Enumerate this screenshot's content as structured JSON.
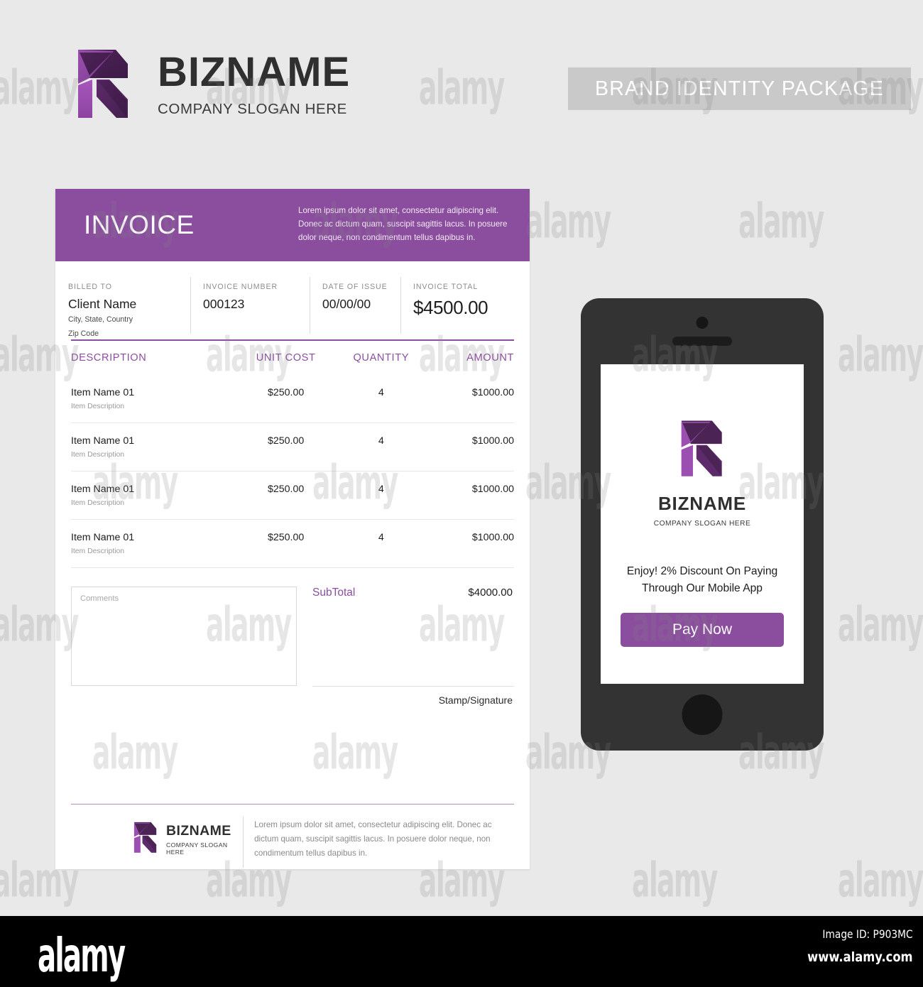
{
  "header": {
    "brand_name": "BIZNAME",
    "slogan": "COMPANY SLOGAN HERE",
    "package_label": "BRAND IDENTITY PACKAGE"
  },
  "colors": {
    "accent_purple": "#8b4e9e",
    "logo_dark": "#4b2455",
    "logo_light": "#9b4fb0",
    "page_background": "#e9e9e9",
    "phone_body": "#333333",
    "banner_grey": "#c9c9c9"
  },
  "invoice": {
    "title": "INVOICE",
    "header_description": "Lorem ipsum dolor sit amet, consectetur adipiscing elit. Donec ac dictum quam, suscipit sagittis lacus. In posuere dolor neque, non condimentum tellus dapibus in.",
    "meta": {
      "billed_to_label": "BILLED TO",
      "billed_to_name": "Client Name",
      "billed_to_line1": "City, State, Country",
      "billed_to_line2": "Zip Code",
      "invoice_number_label": "INVOICE NUMBER",
      "invoice_number_value": "000123",
      "date_of_issue_label": "DATE OF ISSUE",
      "date_of_issue_value": "00/00/00",
      "invoice_total_label": "INVOICE TOTAL",
      "invoice_total_value": "$4500.00"
    },
    "table": {
      "columns": [
        "DESCRIPTION",
        "UNIT COST",
        "QUANTITY",
        "AMOUNT"
      ],
      "rows": [
        {
          "name": "Item Name 01",
          "description": "Item Description",
          "unit_cost": "$250.00",
          "quantity": "4",
          "amount": "$1000.00"
        },
        {
          "name": "Item Name 01",
          "description": "Item Description",
          "unit_cost": "$250.00",
          "quantity": "4",
          "amount": "$1000.00"
        },
        {
          "name": "Item Name 01",
          "description": "Item Description",
          "unit_cost": "$250.00",
          "quantity": "4",
          "amount": "$1000.00"
        },
        {
          "name": "Item Name 01",
          "description": "Item Description",
          "unit_cost": "$250.00",
          "quantity": "4",
          "amount": "$1000.00"
        }
      ]
    },
    "comments_placeholder": "Comments",
    "subtotal_label": "SubTotal",
    "subtotal_value": "$4000.00",
    "stamp_label": "Stamp/Signature",
    "footer": {
      "brand_name": "BIZNAME",
      "slogan": "COMPANY SLOGAN HERE",
      "description": "Lorem ipsum dolor sit amet, consectetur adipiscing elit. Donec ac dictum quam, suscipit sagittis lacus. In posuere dolor neque, non condimentum tellus dapibus in."
    }
  },
  "phone": {
    "brand_name": "BIZNAME",
    "slogan": "COMPANY SLOGAN HERE",
    "promo_text": "Enjoy! 2% Discount On Paying Through Our Mobile App",
    "pay_button_label": "Pay Now"
  },
  "watermark": {
    "text": "alamy",
    "footer_logo": "alamy",
    "image_id": "Image ID: P903MC",
    "url": "www.alamy.com"
  }
}
